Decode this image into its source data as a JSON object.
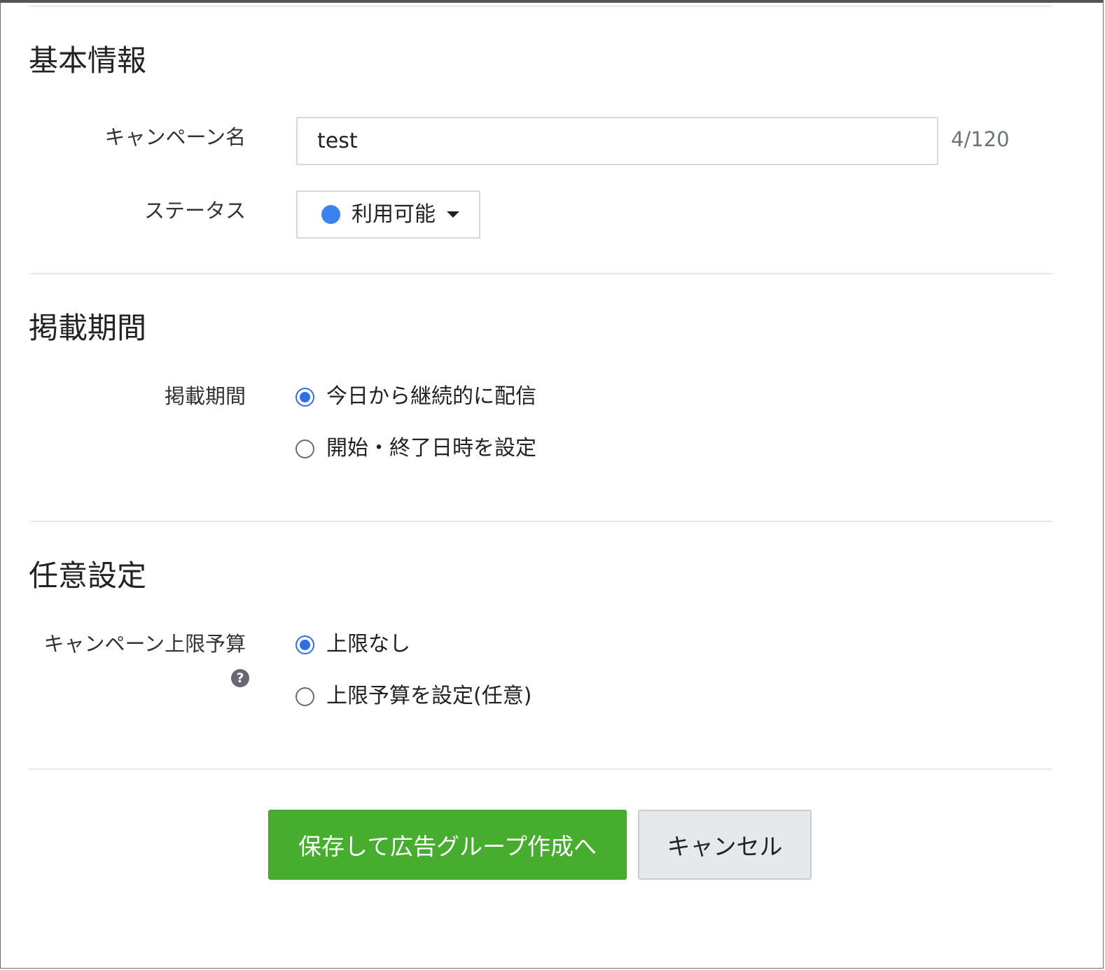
{
  "basic_info": {
    "title": "基本情報",
    "campaign_name_label": "キャンペーン名",
    "campaign_name_value": "test",
    "campaign_name_counter": "4/120",
    "status_label": "ステータス",
    "status_value": "利用可能",
    "status_color": "#3b82f0"
  },
  "period": {
    "title": "掲載期間",
    "field_label": "掲載期間",
    "options": [
      {
        "label": "今日から継続的に配信",
        "checked": true
      },
      {
        "label": "開始・終了日時を設定",
        "checked": false
      }
    ]
  },
  "optional": {
    "title": "任意設定",
    "budget_label": "キャンペーン上限予算",
    "help_icon": "question-circle-icon",
    "options": [
      {
        "label": "上限なし",
        "checked": true
      },
      {
        "label": "上限予算を設定(任意)",
        "checked": false
      }
    ]
  },
  "actions": {
    "save_label": "保存して広告グループ作成へ",
    "cancel_label": "キャンセル",
    "primary_color": "#46ad2f"
  }
}
